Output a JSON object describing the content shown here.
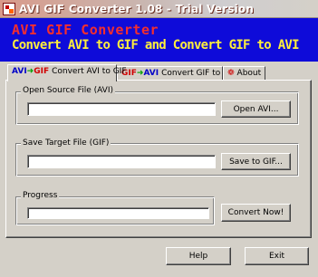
{
  "window": {
    "title": "AVI GIF Converter 1.08 - Trial Version"
  },
  "banner": {
    "title": "AVI GIF Converter",
    "subtitle": "Convert AVI to GIF and Convert GIF to AVI"
  },
  "tabs": [
    {
      "icon_from": "AVI",
      "icon_to": "GIF",
      "label": "Convert AVI to GIF",
      "active": true
    },
    {
      "icon_from": "GIF",
      "icon_to": "AVI",
      "label": "Convert GIF to AVI",
      "active": false
    },
    {
      "label": "About",
      "active": false
    }
  ],
  "source": {
    "label": "Open Source File (AVI)",
    "value": "",
    "button": "Open AVI..."
  },
  "target": {
    "label": "Save Target File (GIF)",
    "value": "",
    "button": "Save to GIF..."
  },
  "progress": {
    "label": "Progress",
    "value": 0,
    "button": "Convert Now!"
  },
  "footer": {
    "help": "Help",
    "exit": "Exit"
  },
  "colors": {
    "banner_bg": "#0e0bd9",
    "banner_title": "#f42e2e",
    "banner_subtitle": "#ffef3c",
    "face": "#d4d0c8"
  }
}
